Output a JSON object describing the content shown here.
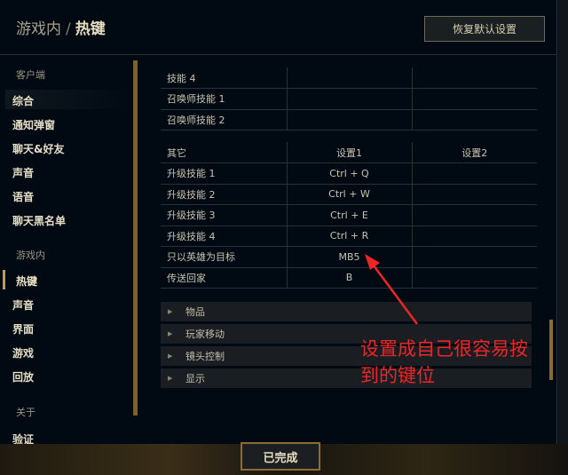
{
  "header": {
    "section": "游戏内",
    "separator": "/",
    "page": "热键",
    "restore_button": "恢复默认设置"
  },
  "sidebar": {
    "client_label": "客户端",
    "client_items": [
      "综合",
      "通知弹窗",
      "聊天&好友",
      "声音",
      "语音",
      "聊天黑名单"
    ],
    "ingame_label": "游戏内",
    "ingame_items": [
      "热键",
      "声音",
      "界面",
      "游戏",
      "回放"
    ],
    "about_label": "关于",
    "about_items": [
      "验证"
    ],
    "active_item": "热键"
  },
  "table_top": {
    "rows": [
      {
        "name": "技能 4",
        "key1": "",
        "key2": ""
      },
      {
        "name": "召唤师技能 1",
        "key1": "",
        "key2": ""
      },
      {
        "name": "召唤师技能 2",
        "key1": "",
        "key2": ""
      }
    ]
  },
  "table_other": {
    "header": {
      "name": "其它",
      "key1": "设置1",
      "key2": "设置2"
    },
    "rows": [
      {
        "name": "升级技能 1",
        "key1": "Ctrl + Q",
        "key2": ""
      },
      {
        "name": "升级技能 2",
        "key1": "Ctrl + W",
        "key2": ""
      },
      {
        "name": "升级技能 3",
        "key1": "Ctrl + E",
        "key2": ""
      },
      {
        "name": "升级技能 4",
        "key1": "Ctrl + R",
        "key2": ""
      },
      {
        "name": "只以英雄为目标",
        "key1": "MB5",
        "key2": ""
      },
      {
        "name": "传送回家",
        "key1": "B",
        "key2": ""
      }
    ]
  },
  "sections": [
    "物品",
    "玩家移动",
    "镜头控制",
    "显示"
  ],
  "annotation": {
    "line1": "设置成自己很容易按",
    "line2": "到的键位",
    "color": "#ec2526"
  },
  "footer": {
    "done_button": "已完成"
  },
  "colors": {
    "gold_accent": "#c89b3c",
    "background": "#010a13",
    "annotation_red": "#ec2526"
  }
}
